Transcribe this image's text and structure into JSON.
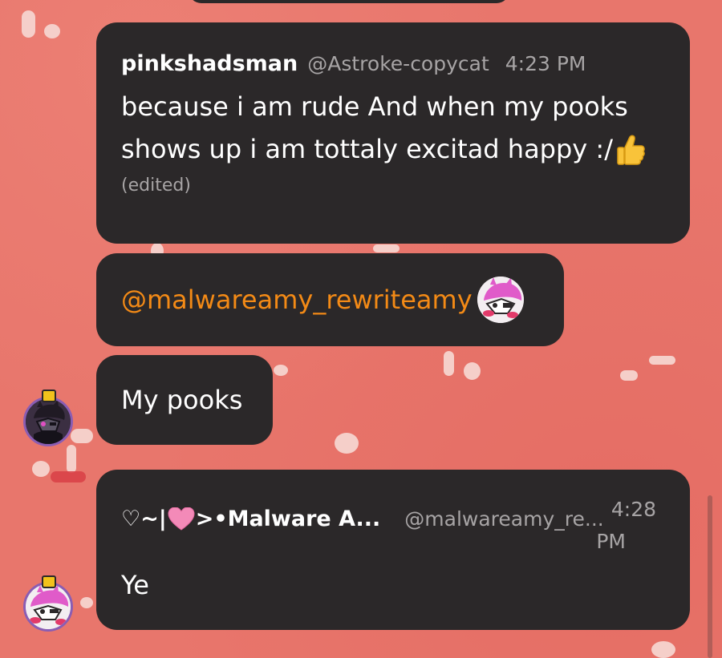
{
  "messages": [
    {
      "author": "pinkshadsman",
      "handle": "@Astroke-copycat",
      "time": "4:23 PM",
      "text_line1": "because i am rude And when my pooks",
      "text_line2": "shows up i am tottaly excitad happy :/",
      "emoji_icon": "thumbs-up-icon",
      "edited": "(edited)"
    },
    {
      "mention": "@malwareamy_rewriteamy",
      "avatar_icon": "mentioned-user-avatar"
    },
    {
      "text": "My pooks"
    },
    {
      "author_prefix": "♡~|",
      "author_suffix": ">•Malware A...",
      "handle": "@malwareamy_re...",
      "time_line1": "4:28",
      "time_line2": "PM",
      "text": "Ye"
    }
  ],
  "colors": {
    "background": "#e8766c",
    "bubble": "#2b2829",
    "mention": "#f38a16",
    "muted": "#a7a4a5"
  }
}
